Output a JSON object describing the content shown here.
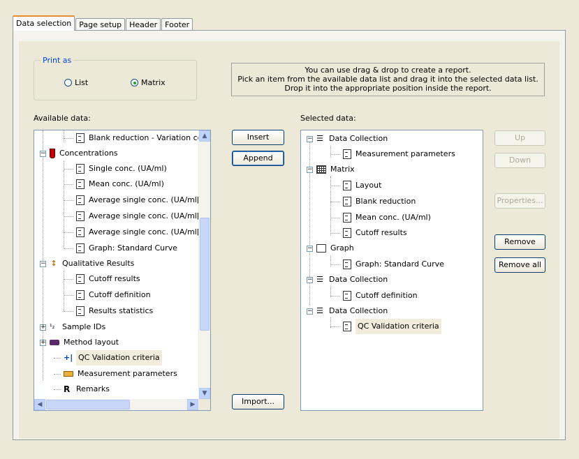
{
  "tabs": [
    "Data selection",
    "Page setup",
    "Header",
    "Footer"
  ],
  "print_as": {
    "legend": "Print as",
    "options": [
      {
        "label": "List",
        "selected": false
      },
      {
        "label": "Matrix",
        "selected": true
      }
    ]
  },
  "info": {
    "line1": "You can use drag & drop to create a report.",
    "line2": "Pick an item from the available data list and drag it into the selected data list.",
    "line3": "Drop it into the appropriate position inside the report."
  },
  "available": {
    "label": "Available data:",
    "items": [
      "Blank reduction - Variation cc",
      "Concentrations",
      "Single conc. (UA/ml)",
      "Mean conc. (UA/ml)",
      "Average single conc. (UA/ml[",
      "Average single conc. (UA/ml[",
      "Average single conc. (UA/ml[",
      "Graph: Standard Curve",
      "Qualitative Results",
      "Cutoff results",
      "Cutoff definition",
      "Results statistics",
      "Sample IDs",
      "Method layout",
      "QC Validation criteria",
      "Measurement parameters",
      "Remarks"
    ]
  },
  "middle_buttons": {
    "insert": "Insert",
    "append": "Append",
    "import": "Import..."
  },
  "selected": {
    "label": "Selected data:",
    "items": [
      "Data Collection",
      "Measurement parameters",
      "Matrix",
      "Layout",
      "Blank reduction",
      "Mean conc. (UA/ml)",
      "Cutoff results",
      "Graph",
      "Graph: Standard Curve",
      "Data Collection",
      "Cutoff definition",
      "Data Collection",
      "QC Validation criteria"
    ]
  },
  "right_buttons": {
    "up": "Up",
    "down": "Down",
    "properties": "Properties...",
    "remove": "Remove",
    "remove_all": "Remove all"
  },
  "colors": {
    "accent_tab": "#e68b2c",
    "legend": "#0046d5",
    "list_border": "#7f9db9"
  },
  "icons": {
    "tree_item": "document-icon",
    "expand": "minus-box-icon",
    "collapse": "plus-box-icon"
  }
}
